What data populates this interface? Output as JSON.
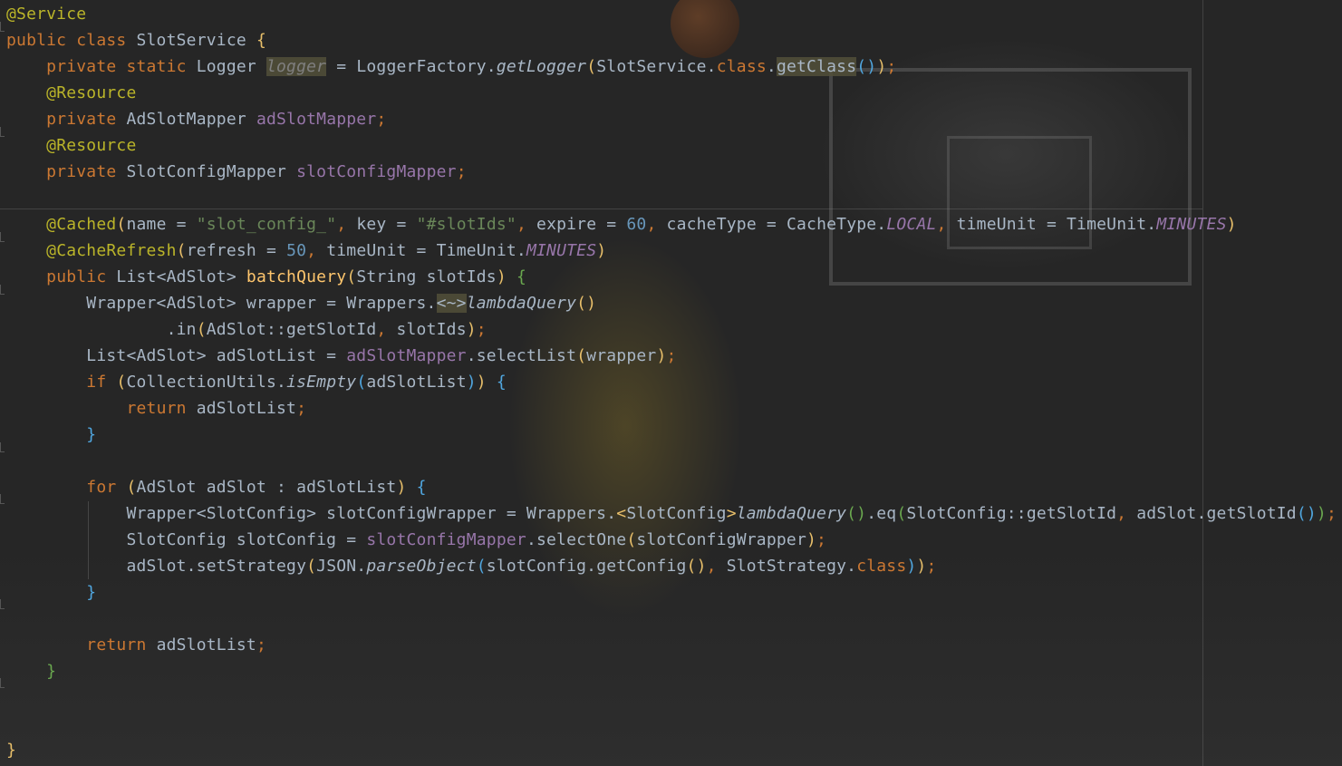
{
  "editor": {
    "lines": [
      {
        "tokens": [
          [
            "ann",
            "@Service"
          ]
        ]
      },
      {
        "tokens": [
          [
            "kw",
            "public class "
          ],
          [
            "txt",
            "SlotService "
          ],
          [
            "brc",
            "{"
          ]
        ]
      },
      {
        "tokens": [
          [
            "txt",
            "    "
          ],
          [
            "kw",
            "private static "
          ],
          [
            "txt",
            "Logger "
          ],
          [
            "unused",
            "logger"
          ],
          [
            "txt",
            " = LoggerFactory."
          ],
          [
            "ital",
            "getLogger"
          ],
          [
            "brc",
            "("
          ],
          [
            "txt",
            "SlotService."
          ],
          [
            "kw",
            "class"
          ],
          [
            "txt",
            "."
          ],
          [
            "hl",
            "getClass"
          ],
          [
            "brg",
            "()"
          ],
          [
            "brc",
            ")"
          ],
          [
            "kw",
            ";"
          ]
        ]
      },
      {
        "tokens": [
          [
            "txt",
            "    "
          ],
          [
            "ann",
            "@Resource"
          ]
        ]
      },
      {
        "tokens": [
          [
            "txt",
            "    "
          ],
          [
            "kw",
            "private "
          ],
          [
            "txt",
            "AdSlotMapper "
          ],
          [
            "fld",
            "adSlotMapper"
          ],
          [
            "kw",
            ";"
          ]
        ]
      },
      {
        "tokens": [
          [
            "txt",
            "    "
          ],
          [
            "ann",
            "@Resource"
          ]
        ]
      },
      {
        "tokens": [
          [
            "txt",
            "    "
          ],
          [
            "kw",
            "private "
          ],
          [
            "txt",
            "SlotConfigMapper "
          ],
          [
            "fld",
            "slotConfigMapper"
          ],
          [
            "kw",
            ";"
          ]
        ]
      },
      {
        "tokens": []
      },
      {
        "tokens": [
          [
            "txt",
            "    "
          ],
          [
            "ann",
            "@Cached"
          ],
          [
            "brc",
            "("
          ],
          [
            "txt",
            "name = "
          ],
          [
            "str",
            "\"slot_config_\""
          ],
          [
            "kw",
            ", "
          ],
          [
            "txt",
            "key = "
          ],
          [
            "str",
            "\"#slotIds\""
          ],
          [
            "kw",
            ", "
          ],
          [
            "txt",
            "expire = "
          ],
          [
            "num",
            "60"
          ],
          [
            "kw",
            ", "
          ],
          [
            "txt",
            "cacheType = CacheType."
          ],
          [
            "cst",
            "LOCAL"
          ],
          [
            "kw",
            ", "
          ],
          [
            "txt",
            "timeUnit = TimeUnit."
          ],
          [
            "cst",
            "MINUTES"
          ],
          [
            "brc",
            ")"
          ]
        ]
      },
      {
        "tokens": [
          [
            "txt",
            "    "
          ],
          [
            "ann",
            "@CacheRefresh"
          ],
          [
            "brc",
            "("
          ],
          [
            "txt",
            "refresh = "
          ],
          [
            "num",
            "50"
          ],
          [
            "kw",
            ", "
          ],
          [
            "txt",
            "timeUnit = TimeUnit."
          ],
          [
            "cst",
            "MINUTES"
          ],
          [
            "brc",
            ")"
          ]
        ]
      },
      {
        "tokens": [
          [
            "txt",
            "    "
          ],
          [
            "kw",
            "public "
          ],
          [
            "txt",
            "List<AdSlot> "
          ],
          [
            "mth",
            "batchQuery"
          ],
          [
            "brc",
            "("
          ],
          [
            "txt",
            "String slotIds"
          ],
          [
            "brc",
            ")"
          ],
          [
            "txt",
            " "
          ],
          [
            "brgreen",
            "{"
          ]
        ]
      },
      {
        "tokens": [
          [
            "txt",
            "        Wrapper<AdSlot> wrapper = Wrappers."
          ],
          [
            "hl",
            "<~>"
          ],
          [
            "ital",
            "lambdaQuery"
          ],
          [
            "brc",
            "()"
          ]
        ]
      },
      {
        "tokens": [
          [
            "txt",
            "                .in"
          ],
          [
            "brc",
            "("
          ],
          [
            "txt",
            "AdSlot::getSlotId"
          ],
          [
            "kw",
            ", "
          ],
          [
            "txt",
            "slotIds"
          ],
          [
            "brc",
            ")"
          ],
          [
            "kw",
            ";"
          ]
        ]
      },
      {
        "tokens": [
          [
            "txt",
            "        List<AdSlot> adSlotList = "
          ],
          [
            "fld",
            "adSlotMapper"
          ],
          [
            "txt",
            ".selectList"
          ],
          [
            "brc",
            "("
          ],
          [
            "txt",
            "wrapper"
          ],
          [
            "brc",
            ")"
          ],
          [
            "kw",
            ";"
          ]
        ]
      },
      {
        "tokens": [
          [
            "txt",
            "        "
          ],
          [
            "kw",
            "if "
          ],
          [
            "brc",
            "("
          ],
          [
            "txt",
            "CollectionUtils."
          ],
          [
            "ital",
            "isEmpty"
          ],
          [
            "brg",
            "("
          ],
          [
            "txt",
            "adSlotList"
          ],
          [
            "brg",
            ")"
          ],
          [
            "brc",
            ")"
          ],
          [
            "txt",
            " "
          ],
          [
            "brg",
            "{"
          ]
        ]
      },
      {
        "tokens": [
          [
            "txt",
            "            "
          ],
          [
            "kw",
            "return "
          ],
          [
            "txt",
            "adSlotList"
          ],
          [
            "kw",
            ";"
          ]
        ]
      },
      {
        "tokens": [
          [
            "txt",
            "        "
          ],
          [
            "brg",
            "}"
          ]
        ]
      },
      {
        "tokens": []
      },
      {
        "tokens": [
          [
            "txt",
            "        "
          ],
          [
            "kw",
            "for "
          ],
          [
            "brc",
            "("
          ],
          [
            "txt",
            "AdSlot adSlot : adSlotList"
          ],
          [
            "brc",
            ")"
          ],
          [
            "txt",
            " "
          ],
          [
            "brg",
            "{"
          ]
        ]
      },
      {
        "tokens": [
          [
            "txt",
            "            Wrapper<SlotConfig> slotConfigWrapper = Wrappers."
          ],
          [
            "brc",
            "<"
          ],
          [
            "txt",
            "SlotConfig"
          ],
          [
            "brc",
            ">"
          ],
          [
            "ital",
            "lambdaQuery"
          ],
          [
            "brgreen",
            "()"
          ],
          [
            "txt",
            ".eq"
          ],
          [
            "brgreen",
            "("
          ],
          [
            "txt",
            "SlotConfig::getSlotId"
          ],
          [
            "kw",
            ", "
          ],
          [
            "txt",
            "adSlot.getSlotId"
          ],
          [
            "brg",
            "()"
          ],
          [
            "brgreen",
            ")"
          ],
          [
            "kw",
            ";"
          ]
        ]
      },
      {
        "tokens": [
          [
            "txt",
            "            SlotConfig slotConfig = "
          ],
          [
            "fld",
            "slotConfigMapper"
          ],
          [
            "txt",
            ".selectOne"
          ],
          [
            "brc",
            "("
          ],
          [
            "txt",
            "slotConfigWrapper"
          ],
          [
            "brc",
            ")"
          ],
          [
            "kw",
            ";"
          ]
        ]
      },
      {
        "tokens": [
          [
            "txt",
            "            adSlot.setStrategy"
          ],
          [
            "brc",
            "("
          ],
          [
            "txt",
            "JSON."
          ],
          [
            "ital",
            "parseObject"
          ],
          [
            "brg",
            "("
          ],
          [
            "txt",
            "slotConfig.getConfig"
          ],
          [
            "brc",
            "()"
          ],
          [
            "kw",
            ", "
          ],
          [
            "txt",
            "SlotStrategy."
          ],
          [
            "kw",
            "class"
          ],
          [
            "brg",
            ")"
          ],
          [
            "brc",
            ")"
          ],
          [
            "kw",
            ";"
          ]
        ]
      },
      {
        "tokens": [
          [
            "txt",
            "        "
          ],
          [
            "brg",
            "}"
          ]
        ]
      },
      {
        "tokens": []
      },
      {
        "tokens": [
          [
            "txt",
            "        "
          ],
          [
            "kw",
            "return "
          ],
          [
            "txt",
            "adSlotList"
          ],
          [
            "kw",
            ";"
          ]
        ]
      },
      {
        "tokens": [
          [
            "txt",
            "    "
          ],
          [
            "brgreen",
            "}"
          ]
        ]
      },
      {
        "tokens": []
      },
      {
        "tokens": []
      },
      {
        "tokens": [
          [
            "brc",
            "}"
          ]
        ]
      }
    ]
  }
}
